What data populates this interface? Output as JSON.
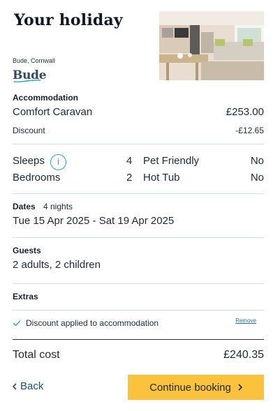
{
  "header": {
    "title": "Your holiday",
    "location": "Bude, Cornwall",
    "brand": "Bude"
  },
  "accommodation": {
    "heading": "Accommodation",
    "name": "Comfort Caravan",
    "price": "£253.00",
    "discount_label": "Discount",
    "discount_value": "-£12.65"
  },
  "features": {
    "sleeps_label": "Sleeps",
    "sleeps_value": "4",
    "info_symbol": "i",
    "pets_label": "Pet Friendly",
    "pets_value": "No",
    "bedrooms_label": "Bedrooms",
    "bedrooms_value": "2",
    "hottub_label": "Hot Tub",
    "hottub_value": "No"
  },
  "dates": {
    "heading": "Dates",
    "nights": "4 nights",
    "range": "Tue 15 Apr 2025 - Sat 19 Apr 2025"
  },
  "guests": {
    "heading": "Guests",
    "value": "2 adults, 2 children"
  },
  "extras": {
    "heading": "Extras",
    "discount_note": "Discount applied to accommodation",
    "remove_label": "Remove"
  },
  "total": {
    "label": "Total cost",
    "value": "£240.35"
  },
  "actions": {
    "back_label": "Back",
    "continue_label": "Continue booking"
  },
  "colors": {
    "accent": "#fbc23c",
    "teal": "#2aa7b3",
    "link": "#2a6fa0",
    "divider": "#cfe2e3"
  },
  "icons": [
    "info-icon",
    "check-icon",
    "chevron-left-icon",
    "chevron-right-icon"
  ]
}
